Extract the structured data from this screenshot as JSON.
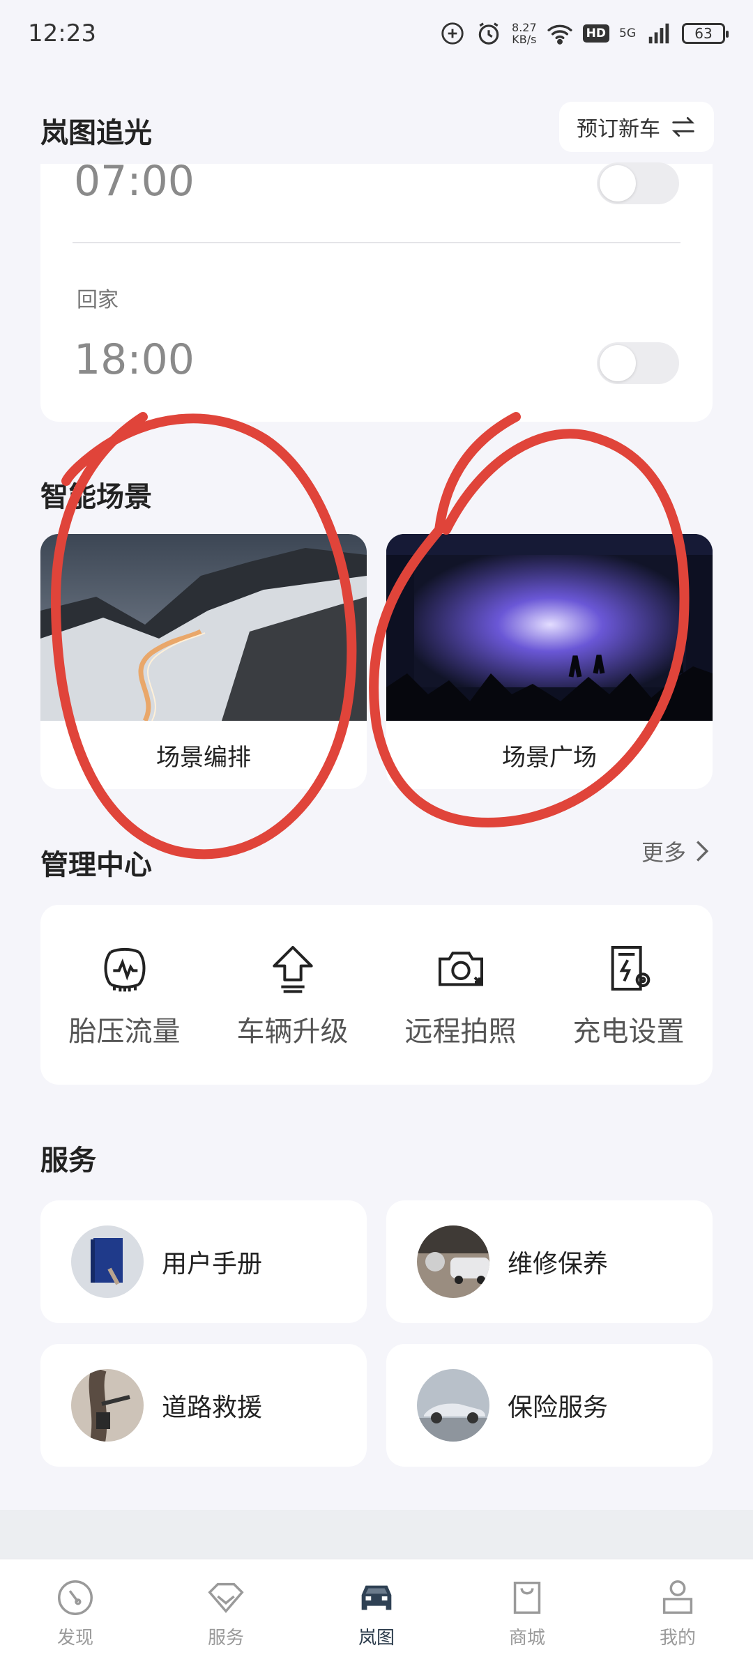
{
  "status_bar": {
    "time": "12:23",
    "net_speed_value": "8.27",
    "net_speed_unit": "KB/s",
    "hd": "HD",
    "network": "5G",
    "battery": "63"
  },
  "header": {
    "title": "岚图追光",
    "reserve_button": "预订新车"
  },
  "schedule": {
    "first_time": "07:00",
    "home_label": "回家",
    "home_time": "18:00"
  },
  "smart_scenes": {
    "title": "智能场景",
    "cards": [
      {
        "label": "场景编排"
      },
      {
        "label": "场景广场"
      }
    ]
  },
  "management": {
    "title": "管理中心",
    "more": "更多",
    "items": [
      {
        "label": "胎压流量",
        "icon": "tire-pressure-icon"
      },
      {
        "label": "车辆升级",
        "icon": "upgrade-arrow-icon"
      },
      {
        "label": "远程拍照",
        "icon": "camera-icon"
      },
      {
        "label": "充电设置",
        "icon": "charging-settings-icon"
      }
    ]
  },
  "services": {
    "title": "服务",
    "items": [
      {
        "label": "用户手册"
      },
      {
        "label": "维修保养"
      },
      {
        "label": "道路救援"
      },
      {
        "label": "保险服务"
      }
    ]
  },
  "bottom_nav": {
    "items": [
      {
        "label": "发现",
        "icon": "compass-icon"
      },
      {
        "label": "服务",
        "icon": "diamond-icon"
      },
      {
        "label": "岚图",
        "icon": "car-icon",
        "active": true
      },
      {
        "label": "商城",
        "icon": "shopping-bag-icon"
      },
      {
        "label": "我的",
        "icon": "profile-icon"
      }
    ]
  },
  "colors": {
    "background": "#f5f5fa",
    "card": "#ffffff",
    "annotation_red": "#e0443a",
    "nav_active": "#2a3a4a"
  }
}
